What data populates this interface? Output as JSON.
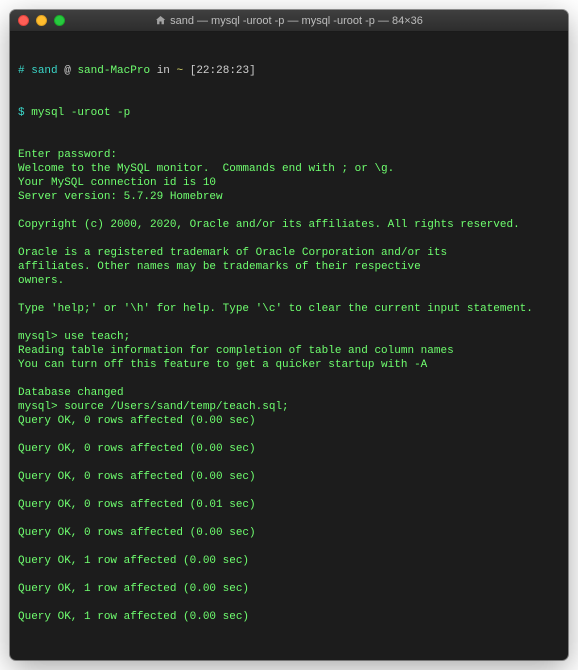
{
  "window": {
    "title": "sand — mysql -uroot -p — mysql -uroot -p — 84×36"
  },
  "prompt": {
    "hash": "#",
    "user": "sand",
    "at": "@",
    "host": "sand-MacPro",
    "in": "in",
    "dir": "~",
    "time": "[22:28:23]",
    "dollar": "$",
    "command": "mysql -uroot -p"
  },
  "lines": [
    "Enter password:",
    "Welcome to the MySQL monitor.  Commands end with ; or \\g.",
    "Your MySQL connection id is 10",
    "Server version: 5.7.29 Homebrew",
    "",
    "Copyright (c) 2000, 2020, Oracle and/or its affiliates. All rights reserved.",
    "",
    "Oracle is a registered trademark of Oracle Corporation and/or its",
    "affiliates. Other names may be trademarks of their respective",
    "owners.",
    "",
    "Type 'help;' or '\\h' for help. Type '\\c' to clear the current input statement.",
    "",
    "mysql> use teach;",
    "Reading table information for completion of table and column names",
    "You can turn off this feature to get a quicker startup with -A",
    "",
    "Database changed",
    "mysql> source /Users/sand/temp/teach.sql;",
    "Query OK, 0 rows affected (0.00 sec)",
    "",
    "Query OK, 0 rows affected (0.00 sec)",
    "",
    "Query OK, 0 rows affected (0.00 sec)",
    "",
    "Query OK, 0 rows affected (0.01 sec)",
    "",
    "Query OK, 0 rows affected (0.00 sec)",
    "",
    "Query OK, 1 row affected (0.00 sec)",
    "",
    "Query OK, 1 row affected (0.00 sec)",
    "",
    "Query OK, 1 row affected (0.00 sec)"
  ]
}
